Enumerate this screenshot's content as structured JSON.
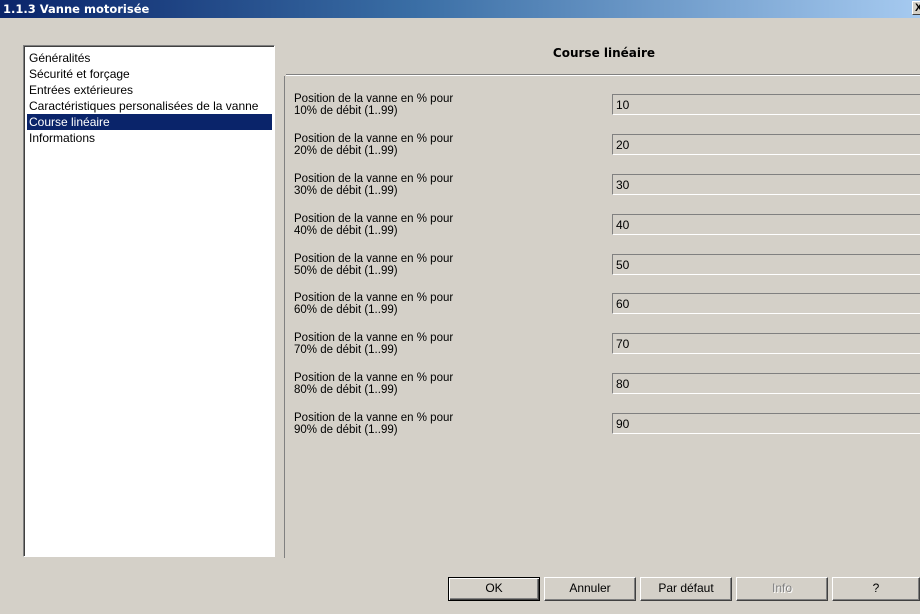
{
  "window": {
    "title": "1.1.3 Vanne motorisée",
    "close_label": "X"
  },
  "sidebar": {
    "items": [
      {
        "label": "Généralités"
      },
      {
        "label": "Sécurité et forçage"
      },
      {
        "label": "Entrées extérieures"
      },
      {
        "label": "Caractéristiques personalisées de la vanne"
      },
      {
        "label": "Course linéaire",
        "selected": true
      },
      {
        "label": "Informations"
      }
    ]
  },
  "panel": {
    "title": "Course linéaire",
    "params": [
      {
        "label": "Position de la vanne en % pour\n10% de débit (1..99)",
        "value": "10"
      },
      {
        "label": "Position de la vanne en % pour\n20% de débit (1..99)",
        "value": "20"
      },
      {
        "label": "Position de la vanne en % pour\n30% de débit (1..99)",
        "value": "30"
      },
      {
        "label": "Position de la vanne en % pour\n40% de débit (1..99)",
        "value": "40"
      },
      {
        "label": "Position de la vanne en % pour\n50% de débit (1..99)",
        "value": "50"
      },
      {
        "label": "Position de la vanne en % pour\n60% de débit (1..99)",
        "value": "60"
      },
      {
        "label": "Position de la vanne en % pour\n70% de débit (1..99)",
        "value": "70"
      },
      {
        "label": "Position de la vanne en % pour\n80% de débit (1..99)",
        "value": "80"
      },
      {
        "label": "Position de la vanne en % pour\n90% de débit (1..99)",
        "value": "90"
      }
    ]
  },
  "buttons": {
    "ok": "OK",
    "cancel": "Annuler",
    "default": "Par défaut",
    "info": "Info",
    "help": "?"
  }
}
